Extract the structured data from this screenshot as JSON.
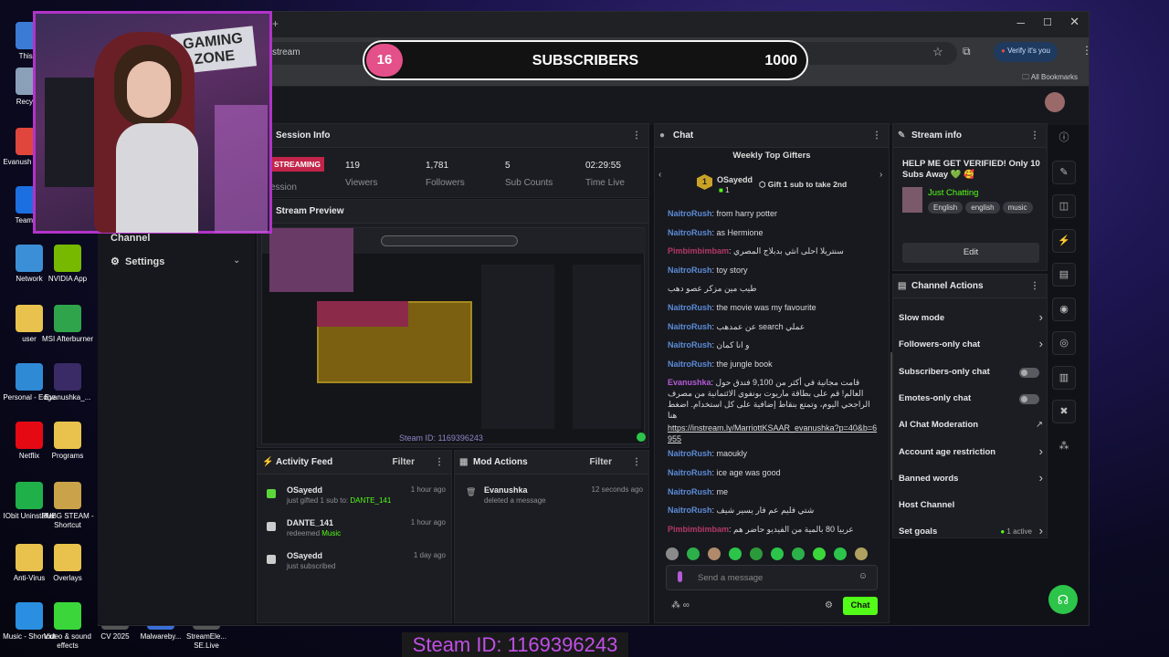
{
  "desktop": {
    "icons": [
      {
        "label": "This P",
        "c": "#3b7bd6"
      },
      {
        "label": "Recycle",
        "c": "#8aa0b8"
      },
      {
        "label": "Evanush Chrom",
        "c": "#e0463b"
      },
      {
        "label": "TeamVie",
        "c": "#1c6fe0"
      },
      {
        "label": "Network",
        "c": "#3b8fd6"
      },
      {
        "label": "NVIDIA App",
        "c": "#76b900"
      },
      {
        "label": "user",
        "c": "#e8c24d"
      },
      {
        "label": "MSI Afterburner",
        "c": "#2fa44a"
      },
      {
        "label": "Personal - Edge",
        "c": "#2f8ad6"
      },
      {
        "label": "Evanushka_...",
        "c": "#3a2b66"
      },
      {
        "label": "Netflix",
        "c": "#e50914"
      },
      {
        "label": "Programs",
        "c": "#e8c24d"
      },
      {
        "label": "IObit Uninstaller",
        "c": "#1fb04a"
      },
      {
        "label": "PUBG STEAM - Shortcut",
        "c": "#c9a24a"
      },
      {
        "label": "Anti-Virus",
        "c": "#e8c24d"
      },
      {
        "label": "Overlays",
        "c": "#e8c24d"
      },
      {
        "label": "Music - Shortcut",
        "c": "#2a8fe0"
      },
      {
        "label": "Video & sound effects",
        "c": "#3ad63a"
      },
      {
        "label": "CV 2025",
        "c": "#555"
      },
      {
        "label": "Malwareby...",
        "c": "#3a6fd6"
      },
      {
        "label": "StreamEle... SE.Live",
        "c": "#555"
      }
    ]
  },
  "browser": {
    "url": "stream",
    "verify": "Verify it's you",
    "bookmarks": "All Bookmarks",
    "new_tab": "+"
  },
  "overlay": {
    "sub_count": "16",
    "sub_label": "SUBSCRIBERS",
    "sub_goal": "1000",
    "webcam_text": "GAMING ZONE",
    "steam_id": "Steam ID: 1169396243"
  },
  "nav": {
    "channel": "Channel",
    "settings": "Settings"
  },
  "session": {
    "title": "Session Info",
    "status": "STREAMING",
    "session_label": "ession",
    "stats": [
      {
        "value": "119",
        "label": "Viewers"
      },
      {
        "value": "1,781",
        "label": "Followers"
      },
      {
        "value": "5",
        "label": "Sub Counts"
      },
      {
        "value": "02:29:55",
        "label": "Time Live"
      }
    ]
  },
  "preview": {
    "title": "Stream Preview"
  },
  "activity": {
    "title": "Activity Feed",
    "filter": "Filter",
    "items": [
      {
        "name": "OSayedd",
        "detail": "just gifted 1 sub to: ",
        "target": "DANTE_141",
        "time": "1 hour ago",
        "c": "#5bd63a"
      },
      {
        "name": "DANTE_141",
        "detail": "redeemed ",
        "target": "Music",
        "time": "1 hour ago",
        "c": "#ccc"
      },
      {
        "name": "OSayedd",
        "detail": "just subscribed",
        "target": "",
        "time": "1 day ago",
        "c": "#ccc"
      }
    ]
  },
  "mod": {
    "title": "Mod Actions",
    "filter": "Filter",
    "items": [
      {
        "name": "Evanushka",
        "detail": "deleted a message",
        "time": "12 seconds ago"
      }
    ]
  },
  "chat": {
    "title": "Chat",
    "gifters_title": "Weekly Top Gifters",
    "gifter_rank": "1",
    "gifter_name": "OSayedd",
    "gifter_count": "1",
    "gift_hint": "Gift 1 sub to take 2nd",
    "messages": [
      {
        "user": "NaitroRush",
        "text": "from harry potter",
        "cls": "nm"
      },
      {
        "user": "NaitroRush",
        "text": "as Hermione",
        "cls": "nm"
      },
      {
        "user": "Pimbimbimbam",
        "text": "سنتريلا احلى انثي بدبلاج المصري",
        "cls": "nm2"
      },
      {
        "user": "NaitroRush",
        "text": "toy story",
        "cls": "nm"
      },
      {
        "user": "",
        "text": "طيب مين مزكر عصو دهب",
        "cls": "nm"
      },
      {
        "user": "NaitroRush",
        "text": "the movie was my favourite",
        "cls": "nm"
      },
      {
        "user": "NaitroRush",
        "text": "عن عمدهب search عملي",
        "cls": "nm"
      },
      {
        "user": "NaitroRush",
        "text": "و انا كمان",
        "cls": "nm"
      },
      {
        "user": "NaitroRush",
        "text": "the jungle book",
        "cls": "nm"
      },
      {
        "user": "Evanushka",
        "text": "قامت مجانية في أكثر من 9,100 فندق حول العالم! قم على بطاقة ماريوت بونفوي الائتمانية من مصرف الراجحي اليوم، وتمتع بنقاط إضافية على كل استخدام. اضغط هنا",
        "cls": "nm3",
        "link": "https://instream.ly/MarriottKSAAR_evanushka?p=40&b=6955"
      },
      {
        "user": "NaitroRush",
        "text": "maoukly",
        "cls": "nm"
      },
      {
        "user": "NaitroRush",
        "text": "ice age was good",
        "cls": "nm"
      },
      {
        "user": "NaitroRush",
        "text": "me",
        "cls": "nm"
      },
      {
        "user": "NaitroRush",
        "text": "شتي فليم عم فار يسير شيف",
        "cls": "nm"
      },
      {
        "user": "Pimbimbimbam",
        "text": "عربيا 80 بالمية من الفيديو حاضر هم",
        "cls": "nm2"
      }
    ],
    "placeholder": "Send a message",
    "send": "Chat"
  },
  "stream_info": {
    "title": "Stream info",
    "headline": "HELP ME GET VERIFIED! Only 10 Subs Away 💚 🥰",
    "category": "Just Chatting",
    "tags": [
      "English",
      "english",
      "music"
    ],
    "edit": "Edit"
  },
  "actions": {
    "title": "Channel Actions",
    "items": [
      {
        "label": "Slow mode",
        "kind": "arrow"
      },
      {
        "label": "Followers-only chat",
        "kind": "arrow"
      },
      {
        "label": "Subscribers-only chat",
        "kind": "toggle"
      },
      {
        "label": "Emotes-only chat",
        "kind": "toggle"
      },
      {
        "label": "AI Chat Moderation",
        "kind": "ext"
      },
      {
        "label": "Account age restriction",
        "kind": "arrow"
      },
      {
        "label": "Banned words",
        "kind": "arrow"
      },
      {
        "label": "Host Channel",
        "kind": "none"
      },
      {
        "label": "Set goals",
        "kind": "goal",
        "extra": "1 active"
      }
    ]
  },
  "colors": {
    "accent": "#53fc18",
    "status": "#c2244a"
  }
}
